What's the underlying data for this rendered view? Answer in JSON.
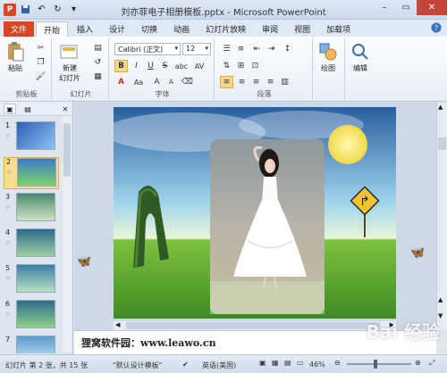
{
  "window": {
    "title": "刘亦菲电子相册模板.pptx - Microsoft PowerPoint",
    "logo_letter": "P"
  },
  "tabs": [
    {
      "label": "文件"
    },
    {
      "label": "开始"
    },
    {
      "label": "插入"
    },
    {
      "label": "设计"
    },
    {
      "label": "切换"
    },
    {
      "label": "动画"
    },
    {
      "label": "幻灯片放映"
    },
    {
      "label": "审阅"
    },
    {
      "label": "视图"
    },
    {
      "label": "加载项"
    }
  ],
  "ribbon": {
    "clipboard": {
      "paste_label": "粘贴",
      "group_label": "剪贴板"
    },
    "slides": {
      "new_slide_label": "新建",
      "new_slide_label2": "幻灯片",
      "group_label": "幻灯片"
    },
    "font": {
      "font_name": "Calibri (正文)",
      "font_size": "12",
      "group_label": "字体",
      "bold": "B",
      "italic": "I",
      "underline": "U",
      "strike": "S",
      "shadow": "abc",
      "spacing": "AV",
      "case": "Aa"
    },
    "paragraph": {
      "group_label": "段落"
    },
    "drawing": {
      "label": "绘图"
    },
    "editing": {
      "label": "编辑"
    }
  },
  "thumbnails": [
    {
      "num": "1"
    },
    {
      "num": "2"
    },
    {
      "num": "3"
    },
    {
      "num": "4"
    },
    {
      "num": "5"
    },
    {
      "num": "6"
    },
    {
      "num": "7"
    }
  ],
  "thumb_star": "☆",
  "notes": {
    "text": "狸窝软件园：www.leawo.cn"
  },
  "status": {
    "slide_info": "幻灯片 第 2 张，共 15 张",
    "theme": "\"默认设计模板\"",
    "language": "英语(美国)",
    "zoom": "46%"
  },
  "watermark": "Bai 经验",
  "sign_symbol": "↱",
  "colors": {
    "file_tab": "#d24726",
    "selected_thumb": "#f9dd8f"
  }
}
